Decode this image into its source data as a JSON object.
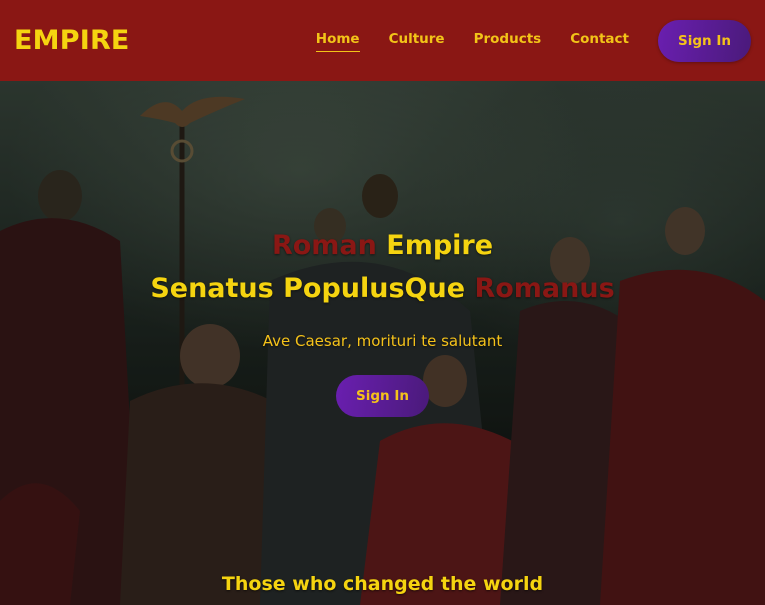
{
  "brand": {
    "name": "EMPIRE"
  },
  "nav": {
    "items": [
      {
        "label": "Home",
        "active": true
      },
      {
        "label": "Culture",
        "active": false
      },
      {
        "label": "Products",
        "active": false
      },
      {
        "label": "Contact",
        "active": false
      }
    ],
    "signin_label": "Sign In"
  },
  "hero": {
    "title_line1": {
      "part1": "Roman",
      "part2": "Empire"
    },
    "title_line2": {
      "part1": "Senatus PopulusQue",
      "part2": "Romanus"
    },
    "tagline": "Ave Caesar, morituri te salutant",
    "signin_label": "Sign In"
  },
  "section": {
    "heading": "Those who changed the world"
  },
  "colors": {
    "navbar_bg": "#8a1714",
    "accent_yellow": "#f5d410",
    "accent_red": "#8a1714",
    "button_purple": "#6a1fb0"
  }
}
